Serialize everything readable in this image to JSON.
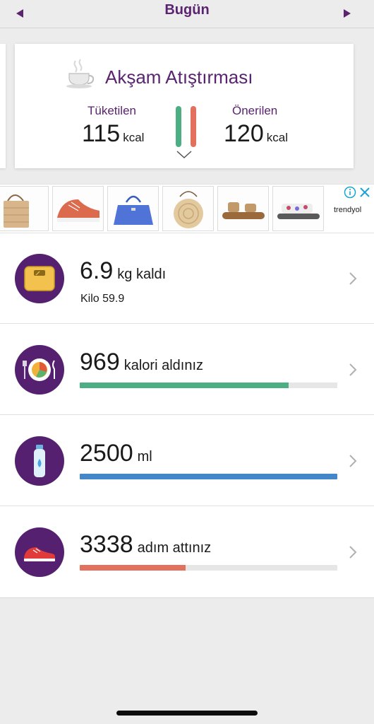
{
  "header": {
    "title": "Bugün",
    "prev_icon": "triangle-left-icon",
    "next_icon": "triangle-right-icon"
  },
  "meal": {
    "title": "Akşam Atıştırması",
    "icon": "teacup-icon",
    "consumed_label": "Tüketilen",
    "consumed_value": "115",
    "recommended_label": "Önerilen",
    "recommended_value": "120",
    "unit": "kcal",
    "colors": {
      "consumed": "#4caf84",
      "recommended": "#e2705c",
      "accent": "#5a2470"
    }
  },
  "ad": {
    "brand": "trendyol",
    "products": [
      "straw-bag",
      "orange-sneaker",
      "blue-handbag",
      "round-rattan-bag",
      "brown-sandal",
      "floral-sandal"
    ],
    "icons": [
      "ad-info-icon",
      "ad-close-icon"
    ]
  },
  "rows": [
    {
      "icon": "scale-icon",
      "value": "6.9",
      "suffix": "kg kaldı",
      "sub": "Kilo 59.9"
    },
    {
      "icon": "plate-icon",
      "value": "969",
      "suffix": "kalori aldınız",
      "progress": 0.81,
      "bar_color": "#4caf84"
    },
    {
      "icon": "water-bottle-icon",
      "value": "2500",
      "suffix": "ml",
      "progress": 1.0,
      "bar_color": "#4287c9"
    },
    {
      "icon": "sneaker-icon",
      "value": "3338",
      "suffix": "adım attınız",
      "progress": 0.41,
      "bar_color": "#e2705c"
    }
  ]
}
